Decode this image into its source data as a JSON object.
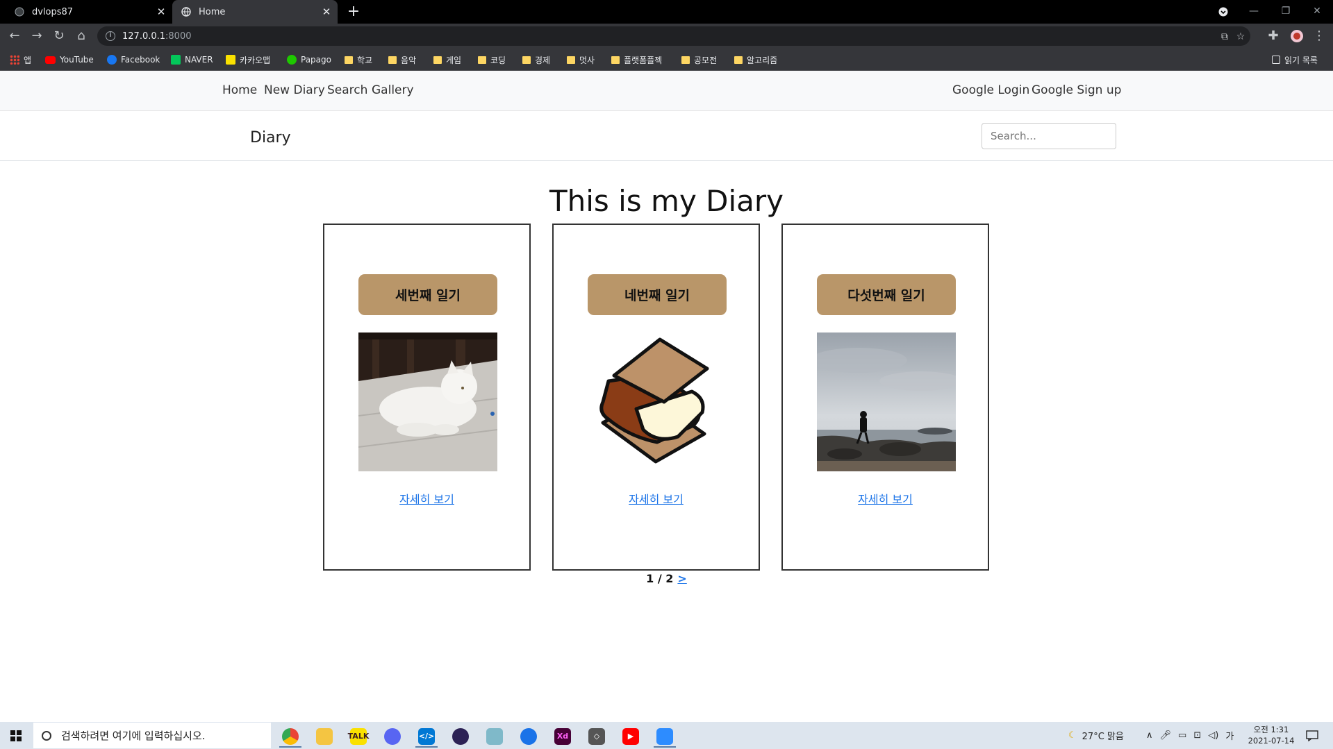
{
  "browser": {
    "tabs": [
      {
        "title": "dvlops87",
        "active": false
      },
      {
        "title": "Home",
        "active": true
      }
    ],
    "url_host": "127.0.0.1",
    "url_port": ":8000",
    "bookmarks": [
      {
        "label": "앱",
        "icon": "apps-grid-icon"
      },
      {
        "label": "YouTube",
        "icon": "youtube-icon"
      },
      {
        "label": "Facebook",
        "icon": "facebook-icon"
      },
      {
        "label": "NAVER",
        "icon": "naver-icon"
      },
      {
        "label": "카카오맵",
        "icon": "kakaomap-icon"
      },
      {
        "label": "Papago",
        "icon": "papago-icon"
      },
      {
        "label": "학교",
        "icon": "folder-icon"
      },
      {
        "label": "음악",
        "icon": "folder-icon"
      },
      {
        "label": "게임",
        "icon": "folder-icon"
      },
      {
        "label": "코딩",
        "icon": "folder-icon"
      },
      {
        "label": "경제",
        "icon": "folder-icon"
      },
      {
        "label": "멋사",
        "icon": "folder-icon"
      },
      {
        "label": "플랫폼플젝",
        "icon": "folder-icon"
      },
      {
        "label": "공모전",
        "icon": "folder-icon"
      },
      {
        "label": "알고리즘",
        "icon": "folder-icon"
      }
    ],
    "reading_list": "읽기 목록"
  },
  "nav": {
    "home": "Home",
    "new_diary": "New Diary",
    "search": "Search",
    "gallery": "Gallery",
    "login": "Google Login",
    "signup": "Google Sign up"
  },
  "subbar": {
    "brand": "Diary",
    "search_placeholder": "Search..."
  },
  "main": {
    "heading": "This is my Diary",
    "cards": [
      {
        "title": "세번째 일기",
        "image": "white-cat-photo",
        "link": "자세히 보기"
      },
      {
        "title": "네번째 일기",
        "image": "smores-illustration",
        "link": "자세히 보기"
      },
      {
        "title": "다섯번째 일기",
        "image": "seaside-photo",
        "link": "자세히 보기"
      }
    ],
    "pager": {
      "text": "1 / 2",
      "next": ">"
    }
  },
  "taskbar": {
    "search_placeholder": "검색하려면 여기에 입력하십시오.",
    "weather": "27°C  맑음",
    "ime": "가",
    "time": "오전 1:31",
    "date": "2021-07-14"
  },
  "colors": {
    "card_title_bg": "#b99669",
    "link": "#1a73e8",
    "chrome_dark": "#35363a"
  }
}
